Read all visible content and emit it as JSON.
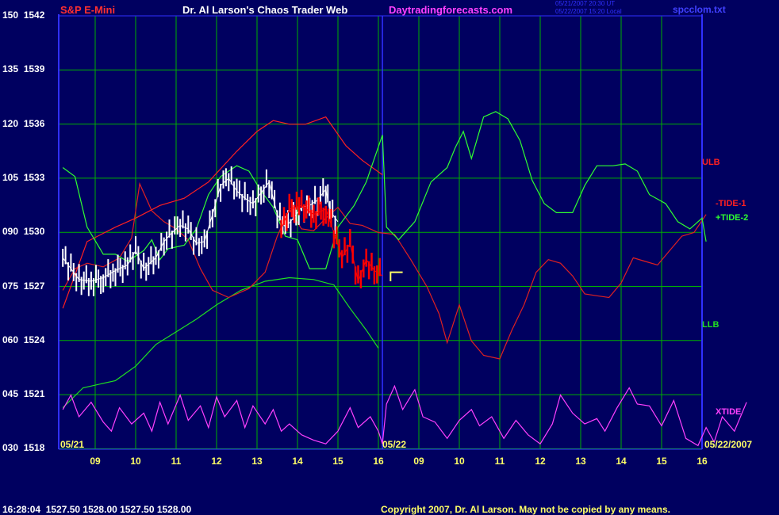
{
  "header": {
    "instrument": "S&P E-Mini",
    "title": "Dr. Al Larson's Chaos Trader Web",
    "website": "Daytradingforecasts.com",
    "timestamp_line1": "05/21/2007 20:30 UT",
    "timestamp_line2": "05/22/2007 15:20 Local",
    "filename": "spcclom.txt"
  },
  "colors": {
    "background": "#000060",
    "grid": "#00b000",
    "axis": "#3030ff",
    "price": "#ffffff",
    "price_forecast": "#ff0000",
    "ulb": "#ff2020",
    "llb": "#20e020",
    "tide1": "#e02020",
    "tide2": "#30ff30",
    "xtide": "#ff40ff",
    "title": "#ffffff",
    "site": "#ff40ff",
    "instrument": "#ff3030",
    "filename": "#4040ff"
  },
  "chart_data": {
    "type": "line",
    "y_left_labels": [
      "150",
      "135",
      "120",
      "105",
      "090",
      "075",
      "060",
      "045",
      "030"
    ],
    "y_right_labels": [
      "1542",
      "1539",
      "1536",
      "1533",
      "1530",
      "1527",
      "1524",
      "1521",
      "1518"
    ],
    "x_tick_labels": [
      "09",
      "10",
      "11",
      "12",
      "13",
      "14",
      "15",
      "16",
      "09",
      "10",
      "11",
      "12",
      "13",
      "14",
      "15",
      "16"
    ],
    "date_labels": {
      "start": "05/21",
      "mid": "05/22",
      "end": "05/22/2007"
    },
    "ylim_osc": [
      30,
      150
    ],
    "ylim_price": [
      1518,
      1542
    ],
    "grid": true,
    "series_labels": {
      "ulb": "ULB",
      "tide1": "-TIDE-1",
      "tide2": "+TIDE-2",
      "llb": "LLB",
      "xtide": "XTIDE"
    },
    "series": {
      "ulb": [
        [
          8.2,
          1525.8
        ],
        [
          8.8,
          1529.5
        ],
        [
          9.5,
          1530.3
        ],
        [
          10,
          1530.8
        ],
        [
          10.6,
          1531.5
        ],
        [
          11.2,
          1531.9
        ],
        [
          11.8,
          1532.8
        ],
        [
          12.5,
          1534.5
        ],
        [
          13,
          1535.6
        ],
        [
          13.4,
          1536.2
        ],
        [
          13.8,
          1536.0
        ],
        [
          14.2,
          1536.0
        ],
        [
          14.7,
          1536.4
        ],
        [
          15.2,
          1534.8
        ],
        [
          15.6,
          1534.0
        ],
        [
          16.1,
          1533.2
        ]
      ],
      "llb": [
        [
          8.2,
          1520.3
        ],
        [
          8.7,
          1521.4
        ],
        [
          9.5,
          1521.8
        ],
        [
          10.0,
          1522.6
        ],
        [
          10.5,
          1523.8
        ],
        [
          11.0,
          1524.5
        ],
        [
          11.5,
          1525.2
        ],
        [
          12.0,
          1526.0
        ],
        [
          12.6,
          1526.8
        ],
        [
          13.2,
          1527.3
        ],
        [
          13.8,
          1527.5
        ],
        [
          14.4,
          1527.4
        ],
        [
          14.9,
          1527.1
        ],
        [
          15.3,
          1525.8
        ],
        [
          15.7,
          1524.6
        ],
        [
          16.0,
          1523.6
        ]
      ],
      "tide1": [
        [
          8.2,
          1526.8
        ],
        [
          8.5,
          1528.0
        ],
        [
          8.8,
          1528.3
        ],
        [
          9.2,
          1528.1
        ],
        [
          9.6,
          1528.6
        ],
        [
          9.9,
          1529.7
        ],
        [
          10.1,
          1532.7
        ],
        [
          10.4,
          1531.2
        ],
        [
          10.7,
          1530.6
        ],
        [
          11.0,
          1530.2
        ],
        [
          11.3,
          1529.6
        ],
        [
          11.6,
          1528.0
        ],
        [
          11.9,
          1526.8
        ],
        [
          12.3,
          1526.4
        ],
        [
          12.8,
          1526.9
        ],
        [
          13.2,
          1527.8
        ],
        [
          13.5,
          1529.8
        ],
        [
          13.8,
          1531.3
        ],
        [
          14.1,
          1530.2
        ],
        [
          14.4,
          1530.1
        ],
        [
          14.7,
          1530.8
        ],
        [
          15.0,
          1531.4
        ],
        [
          15.3,
          1530.5
        ],
        [
          15.6,
          1530.4
        ],
        [
          16.0,
          1530.0
        ],
        [
          16.4,
          1529.9
        ],
        [
          16.8,
          1528.5
        ],
        [
          17.2,
          1527.0
        ],
        [
          17.5,
          1525.5
        ],
        [
          17.7,
          1523.9
        ],
        [
          18.0,
          1526.0
        ],
        [
          18.3,
          1524.0
        ],
        [
          18.6,
          1523.2
        ],
        [
          19.0,
          1523.0
        ],
        [
          19.3,
          1524.6
        ],
        [
          19.6,
          1526.0
        ],
        [
          19.9,
          1527.8
        ],
        [
          20.2,
          1528.5
        ],
        [
          20.5,
          1528.3
        ],
        [
          20.8,
          1527.6
        ],
        [
          21.1,
          1526.6
        ],
        [
          21.4,
          1526.5
        ],
        [
          21.7,
          1526.4
        ],
        [
          22.0,
          1527.2
        ],
        [
          22.3,
          1528.6
        ],
        [
          22.6,
          1528.4
        ],
        [
          22.9,
          1528.2
        ],
        [
          23.2,
          1529.0
        ],
        [
          23.5,
          1529.8
        ],
        [
          23.8,
          1530.0
        ],
        [
          24.1,
          1531.0
        ]
      ],
      "tide2": [
        [
          8.2,
          1533.6
        ],
        [
          8.5,
          1533.1
        ],
        [
          8.8,
          1530.3
        ],
        [
          9.2,
          1528.8
        ],
        [
          9.5,
          1528.8
        ],
        [
          9.8,
          1528.4
        ],
        [
          10.2,
          1529.0
        ],
        [
          10.4,
          1529.6
        ],
        [
          10.6,
          1528.5
        ],
        [
          10.8,
          1529.1
        ],
        [
          11.2,
          1529.3
        ],
        [
          11.5,
          1530.2
        ],
        [
          11.8,
          1532.1
        ],
        [
          12.1,
          1533.1
        ],
        [
          12.5,
          1533.7
        ],
        [
          12.8,
          1533.4
        ],
        [
          13.1,
          1532.3
        ],
        [
          13.4,
          1531.4
        ],
        [
          13.7,
          1529.8
        ],
        [
          14.0,
          1529.6
        ],
        [
          14.3,
          1528.0
        ],
        [
          14.7,
          1528.0
        ],
        [
          15.0,
          1530.3
        ],
        [
          15.4,
          1531.5
        ],
        [
          15.7,
          1532.8
        ],
        [
          16.1,
          1535.4
        ],
        [
          16.2,
          1530.3
        ],
        [
          16.5,
          1529.6
        ],
        [
          16.9,
          1530.6
        ],
        [
          17.3,
          1532.8
        ],
        [
          17.7,
          1533.6
        ],
        [
          17.9,
          1534.7
        ],
        [
          18.1,
          1535.6
        ],
        [
          18.3,
          1534.1
        ],
        [
          18.6,
          1536.4
        ],
        [
          18.9,
          1536.7
        ],
        [
          19.2,
          1536.3
        ],
        [
          19.5,
          1535.1
        ],
        [
          19.8,
          1532.9
        ],
        [
          20.1,
          1531.6
        ],
        [
          20.4,
          1531.1
        ],
        [
          20.8,
          1531.1
        ],
        [
          21.1,
          1532.6
        ],
        [
          21.4,
          1533.7
        ],
        [
          21.8,
          1533.7
        ],
        [
          22.1,
          1533.8
        ],
        [
          22.4,
          1533.4
        ],
        [
          22.7,
          1532.1
        ],
        [
          23.1,
          1531.6
        ],
        [
          23.4,
          1530.6
        ],
        [
          23.7,
          1530.2
        ],
        [
          24.0,
          1530.8
        ],
        [
          24.1,
          1529.5
        ]
      ],
      "xtide": [
        [
          8.2,
          1520.2
        ],
        [
          8.4,
          1521.0
        ],
        [
          8.6,
          1519.8
        ],
        [
          8.9,
          1520.6
        ],
        [
          9.2,
          1519.5
        ],
        [
          9.4,
          1519.0
        ],
        [
          9.6,
          1520.3
        ],
        [
          9.9,
          1519.4
        ],
        [
          10.2,
          1520.0
        ],
        [
          10.4,
          1519.0
        ],
        [
          10.6,
          1520.6
        ],
        [
          10.8,
          1519.4
        ],
        [
          11.1,
          1521.0
        ],
        [
          11.3,
          1519.6
        ],
        [
          11.6,
          1520.4
        ],
        [
          11.8,
          1519.2
        ],
        [
          12.0,
          1520.9
        ],
        [
          12.2,
          1519.8
        ],
        [
          12.5,
          1520.7
        ],
        [
          12.7,
          1519.2
        ],
        [
          12.9,
          1520.4
        ],
        [
          13.2,
          1519.4
        ],
        [
          13.4,
          1520.2
        ],
        [
          13.6,
          1519.0
        ],
        [
          13.8,
          1519.4
        ],
        [
          14.1,
          1518.8
        ],
        [
          14.4,
          1518.5
        ],
        [
          14.7,
          1518.3
        ],
        [
          15.0,
          1519.0
        ],
        [
          15.3,
          1520.3
        ],
        [
          15.5,
          1519.2
        ],
        [
          15.8,
          1519.8
        ],
        [
          16.0,
          1519.0
        ],
        [
          16.1,
          1518.3
        ],
        [
          16.2,
          1520.5
        ],
        [
          16.4,
          1521.5
        ],
        [
          16.6,
          1520.2
        ],
        [
          16.9,
          1521.3
        ],
        [
          17.1,
          1519.8
        ],
        [
          17.4,
          1519.5
        ],
        [
          17.7,
          1518.6
        ],
        [
          18.0,
          1519.6
        ],
        [
          18.3,
          1520.2
        ],
        [
          18.5,
          1519.3
        ],
        [
          18.8,
          1519.8
        ],
        [
          19.1,
          1518.6
        ],
        [
          19.4,
          1519.6
        ],
        [
          19.7,
          1518.8
        ],
        [
          20.0,
          1518.3
        ],
        [
          20.3,
          1519.4
        ],
        [
          20.5,
          1521.0
        ],
        [
          20.8,
          1520.0
        ],
        [
          21.1,
          1519.4
        ],
        [
          21.4,
          1519.7
        ],
        [
          21.6,
          1519.0
        ],
        [
          21.9,
          1520.3
        ],
        [
          22.2,
          1521.4
        ],
        [
          22.4,
          1520.5
        ],
        [
          22.7,
          1520.4
        ],
        [
          23.0,
          1519.3
        ],
        [
          23.3,
          1520.7
        ],
        [
          23.6,
          1518.6
        ],
        [
          23.9,
          1518.2
        ],
        [
          24.1,
          1519.2
        ],
        [
          24.3,
          1518.4
        ],
        [
          24.5,
          1519.8
        ],
        [
          24.8,
          1519.0
        ],
        [
          25.1,
          1520.6
        ]
      ],
      "price": [
        [
          8.2,
          1528.6
        ],
        [
          8.4,
          1528.0
        ],
        [
          8.6,
          1527.4
        ],
        [
          8.9,
          1527.3
        ],
        [
          9.2,
          1527.5
        ],
        [
          9.5,
          1527.9
        ],
        [
          9.8,
          1528.2
        ],
        [
          10.0,
          1529.0
        ],
        [
          10.2,
          1528.0
        ],
        [
          10.5,
          1528.6
        ],
        [
          10.7,
          1529.5
        ],
        [
          10.9,
          1530.0
        ],
        [
          11.1,
          1530.4
        ],
        [
          11.3,
          1530.2
        ],
        [
          11.5,
          1529.4
        ],
        [
          11.7,
          1529.5
        ],
        [
          11.9,
          1531.0
        ],
        [
          12.1,
          1532.6
        ],
        [
          12.3,
          1533.0
        ],
        [
          12.5,
          1532.3
        ],
        [
          12.7,
          1531.9
        ],
        [
          12.9,
          1531.6
        ],
        [
          13.1,
          1532.2
        ],
        [
          13.3,
          1532.8
        ],
        [
          13.5,
          1531.0
        ],
        [
          13.7,
          1530.3
        ],
        [
          13.9,
          1530.8
        ],
        [
          14.1,
          1531.4
        ],
        [
          14.3,
          1531.5
        ],
        [
          14.5,
          1531.8
        ],
        [
          14.7,
          1532.4
        ],
        [
          14.8,
          1531.2
        ],
        [
          15.0,
          1530.6
        ]
      ],
      "price_forecast": [
        [
          13.6,
          1530.2
        ],
        [
          13.8,
          1531.3
        ],
        [
          14.1,
          1531.5
        ],
        [
          14.4,
          1531.0
        ],
        [
          14.7,
          1531.3
        ],
        [
          14.9,
          1530.0
        ],
        [
          15.1,
          1528.6
        ],
        [
          15.3,
          1529.4
        ],
        [
          15.5,
          1527.3
        ],
        [
          15.7,
          1528.5
        ],
        [
          15.9,
          1527.9
        ],
        [
          16.1,
          1527.6
        ]
      ]
    }
  },
  "footer": {
    "quote": "16:28:04  1527.50 1528.00 1527.50 1528.00",
    "copyright": "Copyright 2007, Dr. Al Larson. May not be copied by any means."
  }
}
